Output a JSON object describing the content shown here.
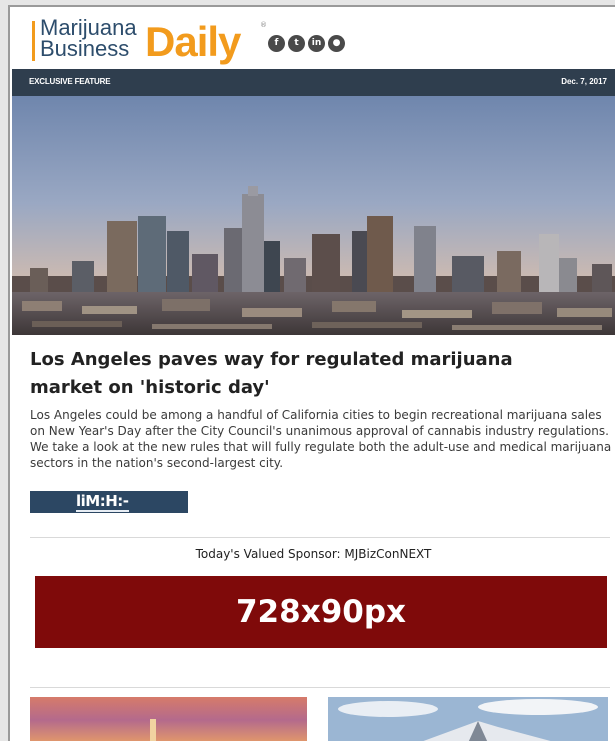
{
  "brand": {
    "line1": "Marijuana",
    "line2": "Business",
    "daily": "Daily",
    "reg": "®",
    "accent_color": "#f29b1d",
    "navy_color": "#2d4d6c"
  },
  "social_icons": [
    {
      "name": "facebook-icon",
      "glyph": "f"
    },
    {
      "name": "twitter-icon",
      "glyph": "t"
    },
    {
      "name": "linkedin-icon",
      "glyph": "in"
    },
    {
      "name": "rss-icon",
      "glyph": "●"
    }
  ],
  "strip": {
    "label": "EXCLUSIVE FEATURE",
    "date": "Dec. 7, 2017"
  },
  "article": {
    "title": "Los Angeles paves way for regulated marijuana market on 'historic day'",
    "body": "Los Angeles could be among a handful of California cities to begin recreational marijuana sales on New Year's Day after the City Council's unanimous approval of cannabis industry regulations. We take a look at the new rules that will fully regulate both the adult-use and medical marijuana sectors in the nation's second-largest city.",
    "button_text": "liM:H:-"
  },
  "sponsor": {
    "label": "Today's Valued Sponsor: MJBizConNEXT",
    "ad_text": "728x90px",
    "ad_color": "#7f0a0a"
  }
}
